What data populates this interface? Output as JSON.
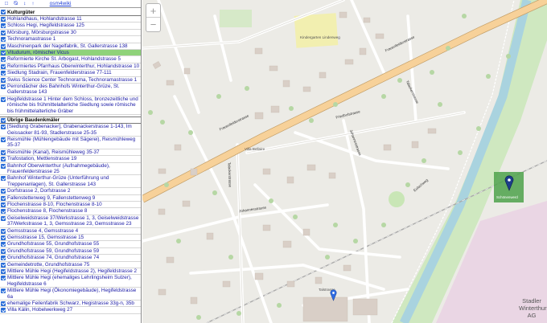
{
  "topbar": {
    "controls": [
      "□",
      "⦰",
      "↕",
      "↑"
    ],
    "osm_link": "osm4wiki"
  },
  "sections": [
    {
      "title": "Kulturgüter",
      "items": [
        "Hohlandhaus, Hohlandstrasse 11",
        "Schloss Hegi, Hegifeldstrasse 125",
        "Mörsburg, Mörsburgstrasse 30",
        "Technoramastrasse 1",
        "Maschinenpark der Nagelfabrik, St. Gallerstrasse 138",
        "Vitudurum, römischer Vicus",
        "Reformierte Kirche St. Arbogast, Hohlandstrasse 5",
        "Reformiertes Pfarrhaus Oberwinterthur, Hohlandstrasse 10",
        "Siedlung Stadrain, Frauenfelderstrasse 77-111",
        "Swiss Science Center Technorama, Technoramastrasse 1",
        "Perrondächer des Bahnhofs Winterthur-Grüze, St. Gallerstrasse 143",
        "Hegifeldstrasse 1 Hinter dem Schloss, bronzezeitliche und römische bis frühmittelalterliche Siedlung sowie römische bis frühmittelalterliche Gräber"
      ],
      "active_index": 5
    },
    {
      "title": "Übrige Baudenkmäler",
      "items": [
        "[Siedlung Grabenacker], Grabenackerstrasse 1-143, Im Geissacker 81-93, Stadlerstrasse 25-35",
        "Reismühle (Mühlengebäude mit Sägerei), Reismühleweg 35-37",
        "Reismühle (Kanal), Reismühleweg 35-37",
        "Trafostation, Mettlenstrasse 19",
        "Bahnhof Oberwinterthur (Aufnahmegebäude), Frauenfelderstrasse 25",
        "Bahnhof Winterthur-Grüze (Unterführung und Treppenanlagen), St. Gallerstrasse 143",
        "Dorfstrasse 2, Dorfstrasse 2",
        "Fallenstettenweg 9, Fallenstettenweg 9",
        "Flochenstrasse 8-10, Flochenstrasse 8-10",
        "Flochenstrasse 8, Flochenstrasse 8",
        "Geiselweidstrasse 37/Werkstrasse 1, 3, Geiselweidstrasse 37/Werkstrasse 1, 3, Gemsstrasse 23, Gemsstrasse 23",
        "Gemsstrasse 4, Gemsstrasse 4",
        "Gemsstrasse 15, Gemsstrasse 15",
        "Grundhofstrasse 55, Grundhofstrasse 55",
        "Grundhofstrasse 59, Grundhofstrasse 59",
        "Grundhofstrasse 74, Grundhofstrasse 74",
        "Gemeindetrotte, Grundhofstrasse 75",
        "Mittlere Mühle Hegi (Hegifeldstrasse 2), Hegifeldstrasse 2",
        "Mittlere Mühle Hegi (ehemaliges Lehrlingsheim Sulzer), Hegifeldstrasse 6",
        "Mittlere Mühle Hegi (Ökonomiegebäude), Hegifeldstrasse 6a",
        "ehemalige Feilenfabrik Schwarz, Hegistrasse 33g-n, 35b",
        "Villa Kälin, Hobelwerkweg 27"
      ]
    }
  ],
  "map": {
    "zoom_in": "+",
    "zoom_out": "−",
    "labels": {
      "frauenfelderstrasse": "Frauenfelderstrasse",
      "frauenfelderstrasse2": "Frauenfelderstrasse",
      "johannesstrasse": "Johannesstrasse",
      "johannesstrasse2": "Johannesstrasse",
      "friedhofstrasse": "Friedhofstrasse",
      "talackerstrasse": "Talackerstrasse",
      "talackerstrasse2": "Talackerstrasse",
      "eulachweg": "Eulachweg",
      "kindergarten": "Kindergarten Lindenweg",
      "villa_bellaire": "Villa Bellaire",
      "stadler": "Stadler Winterthur AG",
      "schoenenwerd": "Schönenwerd",
      "talstrasse": "Talstrasse"
    },
    "colors": {
      "main_road": "#f7d199",
      "river": "#a9d3df",
      "green": "#c9e6b6",
      "industrial": "#ead6e4",
      "building": "#d9cfc7",
      "highlight": "#4da24a"
    }
  }
}
